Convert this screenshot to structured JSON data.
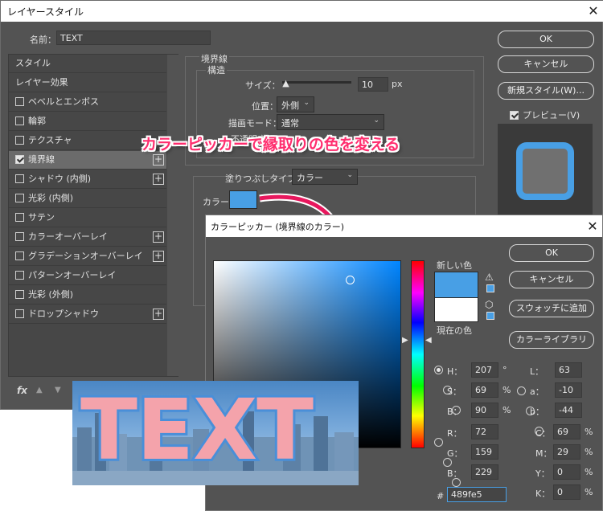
{
  "layer_style": {
    "title": "レイヤースタイル",
    "name_label": "名前：",
    "name_value": "TEXT",
    "ok": "OK",
    "cancel": "キャンセル",
    "new_style": "新規スタイル(W)...",
    "preview": "プレビュー(V)",
    "list": [
      {
        "label": "スタイル",
        "checkbox": false,
        "plus": false
      },
      {
        "label": "レイヤー効果",
        "checkbox": false,
        "plus": false
      },
      {
        "label": "ベベルとエンボス",
        "checkbox": true,
        "checked": false,
        "plus": false
      },
      {
        "label": "輪郭",
        "checkbox": true,
        "checked": false,
        "plus": false
      },
      {
        "label": "テクスチャ",
        "checkbox": true,
        "checked": false,
        "plus": false
      },
      {
        "label": "境界線",
        "checkbox": true,
        "checked": true,
        "plus": true
      },
      {
        "label": "シャドウ (内側)",
        "checkbox": true,
        "checked": false,
        "plus": true
      },
      {
        "label": "光彩 (内側)",
        "checkbox": true,
        "checked": false,
        "plus": false
      },
      {
        "label": "サテン",
        "checkbox": true,
        "checked": false,
        "plus": false
      },
      {
        "label": "カラーオーバーレイ",
        "checkbox": true,
        "checked": false,
        "plus": true
      },
      {
        "label": "グラデーションオーバーレイ",
        "checkbox": true,
        "checked": false,
        "plus": true
      },
      {
        "label": "パターンオーバーレイ",
        "checkbox": true,
        "checked": false,
        "plus": false
      },
      {
        "label": "光彩 (外側)",
        "checkbox": true,
        "checked": false,
        "plus": false
      },
      {
        "label": "ドロップシャドウ",
        "checkbox": true,
        "checked": false,
        "plus": true
      }
    ],
    "fx_label": "fx",
    "stroke": {
      "group_title": "境界線",
      "structure_title": "構造",
      "size_label": "サイズ：",
      "size_value": "10",
      "size_unit": "px",
      "size_slider_fraction": 0.05,
      "position_label": "位置：",
      "position_value": "外側",
      "blend_label": "描画モード：",
      "blend_value": "通常",
      "opacity_label_partial": "不透明度",
      "fill_type_label": "塗りつぶしタイプ：",
      "fill_type_value": "カラー",
      "color_label": "カラー："
    }
  },
  "callout": "カラーピッカーで縁取りの色を変える",
  "color_picker": {
    "title": "カラーピッカー (境界線のカラー)",
    "new_label": "新しい色",
    "current_label": "現在の色",
    "ok": "OK",
    "cancel": "キャンセル",
    "add_swatch": "スウォッチに追加",
    "color_library": "カラーライブラリ",
    "hsb": [
      {
        "label": "H：",
        "value": "207",
        "unit": "°",
        "selected": true
      },
      {
        "label": "S：",
        "value": "69",
        "unit": "%",
        "selected": false
      },
      {
        "label": "B：",
        "value": "90",
        "unit": "%",
        "selected": false
      }
    ],
    "rgb": [
      {
        "label": "R：",
        "value": "72"
      },
      {
        "label": "G：",
        "value": "159"
      },
      {
        "label": "B：",
        "value": "229"
      }
    ],
    "lab": [
      {
        "label": "L：",
        "value": "63"
      },
      {
        "label": "a：",
        "value": "-10"
      },
      {
        "label": "b：",
        "value": "-44"
      }
    ],
    "cmyk": [
      {
        "label": "C：",
        "value": "69",
        "unit": "%"
      },
      {
        "label": "M：",
        "value": "29",
        "unit": "%"
      },
      {
        "label": "Y：",
        "value": "0",
        "unit": "%"
      },
      {
        "label": "K：",
        "value": "0",
        "unit": "%"
      }
    ],
    "hex_label": "#",
    "hex_value": "489fe5"
  },
  "illustration_text": "TEXT",
  "colors": {
    "stroke_color": "#489fe5",
    "current_color": "#ffffff",
    "callout_color": "#ff2d6e",
    "text_fill": "#f4a3ab"
  }
}
